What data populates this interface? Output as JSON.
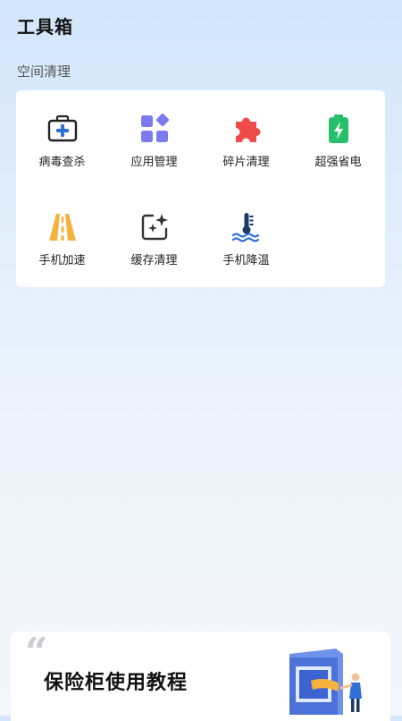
{
  "header": {
    "title": "工具箱"
  },
  "section": {
    "label": "空间清理"
  },
  "tools": [
    {
      "label": "病毒查杀",
      "icon": "medical-kit-icon"
    },
    {
      "label": "应用管理",
      "icon": "app-grid-icon"
    },
    {
      "label": "碎片清理",
      "icon": "puzzle-piece-icon"
    },
    {
      "label": "超强省电",
      "icon": "battery-charge-icon"
    },
    {
      "label": "手机加速",
      "icon": "road-icon"
    },
    {
      "label": "缓存清理",
      "icon": "sparkle-image-icon"
    },
    {
      "label": "手机降温",
      "icon": "thermometer-water-icon"
    }
  ],
  "banner": {
    "title": "保险柜使用教程"
  },
  "colors": {
    "blue": "#2f6fd6",
    "purple": "#7b7bf0",
    "red": "#ef4b4b",
    "green": "#27c06a",
    "orange": "#f6b23e",
    "navy": "#1d3a66"
  }
}
